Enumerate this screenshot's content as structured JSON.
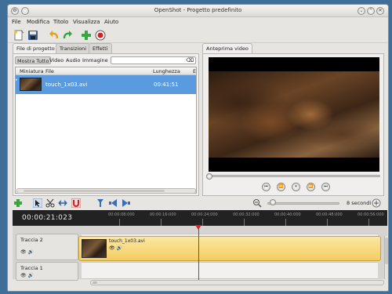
{
  "window": {
    "title": "OpenShot - Progetto predefinito"
  },
  "menubar": [
    "File",
    "Modifica",
    "Titolo",
    "Visualizza",
    "Aiuto"
  ],
  "toolbar": {
    "icons": [
      "new-project-icon",
      "save-icon",
      "undo-icon",
      "redo-icon",
      "add-file-icon",
      "record-icon"
    ]
  },
  "left_tabs": [
    "File di progetto",
    "Transizioni",
    "Effetti"
  ],
  "filters": [
    "Mostra Tutto",
    "Video",
    "Audio",
    "Immagine"
  ],
  "search": {
    "value": ""
  },
  "file_table": {
    "columns": [
      "Miniatura",
      "File",
      "Lunghezza",
      "E"
    ],
    "rows": [
      {
        "file": "touch_1x03.avi",
        "length": "00:41:51"
      }
    ]
  },
  "preview": {
    "tab": "Anteprima video"
  },
  "playback": [
    "skip-start-icon",
    "rewind-icon",
    "pause-icon",
    "fast-forward-icon",
    "skip-end-icon"
  ],
  "timeline": {
    "timecode": "00:00:21:023",
    "zoom_label": "8 secondi",
    "ticks": [
      "00:00:08:000",
      "00:00:16:000",
      "00:00:24:000",
      "00:00:32:000",
      "00:00:40:000",
      "00:00:48:000",
      "00:00:56:000"
    ],
    "tracks": [
      {
        "name": "Traccia 2",
        "clip": "touch_1x03.avi"
      },
      {
        "name": "Traccia 1"
      }
    ]
  },
  "colors": {
    "selection": "#5a9be0",
    "clip": "#f3cd62",
    "playhead": "#e02020",
    "ruler": "#222222"
  }
}
